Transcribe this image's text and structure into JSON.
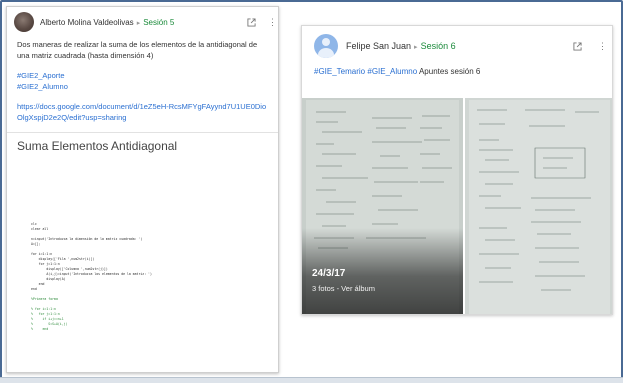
{
  "left_post": {
    "author": "Alberto Molina Valdeolivas",
    "community": "Sesión 5",
    "text": "Dos maneras de realizar la suma de los elementos de la antidiagonal de una matriz cuadrada (hasta dimensión 4)",
    "tags": [
      "#GIE2_Aporte",
      "#GIE2_Alumno"
    ],
    "link": "https://docs.google.com/document/d/1eZ5eH-RcsMFYgFAyynd7U1UE0DioOlgXspjD2e2Q/edit?usp=sharing",
    "doc_title": "Suma Elementos Antidiagonal",
    "code_lines": [
      "clc",
      "clear all",
      "",
      "n=input('Introduzca la dimensión de la matriz cuadrada: ')",
      "A=[];",
      "",
      "for i=1:1:n",
      "    display(['Fila ',num2str(i)])",
      "    for j=1:1:n",
      "        display(['Columna ',num2str(j)])",
      "        A(i,j)=input('Introduzca los elementos de la matriz: ')",
      "        display(A)",
      "    end",
      "end",
      "",
      "%Primera forma",
      "",
      "% for i=1:1:n",
      "%   for j=1:1:n",
      "%     if i+j==n+1",
      "%        S=S+A(i,j)",
      "%     end"
    ]
  },
  "right_post": {
    "author": "Felipe San Juan",
    "community": "Sesión 6",
    "tags": [
      "#GIE_Temario",
      "#GIE_Alumno"
    ],
    "text": "Apuntes sesión 6",
    "album_date": "24/3/17",
    "album_count": "3 fotos - Ver álbum"
  },
  "icons": {
    "open_external": "open-in-new-icon",
    "more": "more-vert-icon",
    "arrow": "▸"
  },
  "colors": {
    "community_green": "#1a8a3a",
    "link_blue": "#2a6fd1",
    "frame_border": "#4a6a94"
  }
}
